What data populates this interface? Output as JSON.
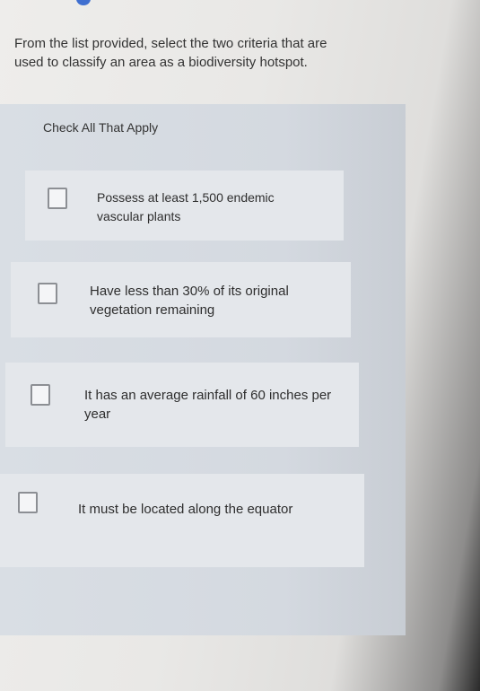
{
  "question": {
    "text": "From the list provided, select the two criteria that are used to classify an area as a biodiversity hotspot."
  },
  "instruction": "Check All That Apply",
  "options": [
    {
      "label": "Possess at least 1,500 endemic vascular plants",
      "checked": false
    },
    {
      "label": "Have less than 30% of its original vegetation remaining",
      "checked": false
    },
    {
      "label": "It has an average rainfall of 60 inches per year",
      "checked": false
    },
    {
      "label": "It must be located along the equator",
      "checked": false
    }
  ]
}
